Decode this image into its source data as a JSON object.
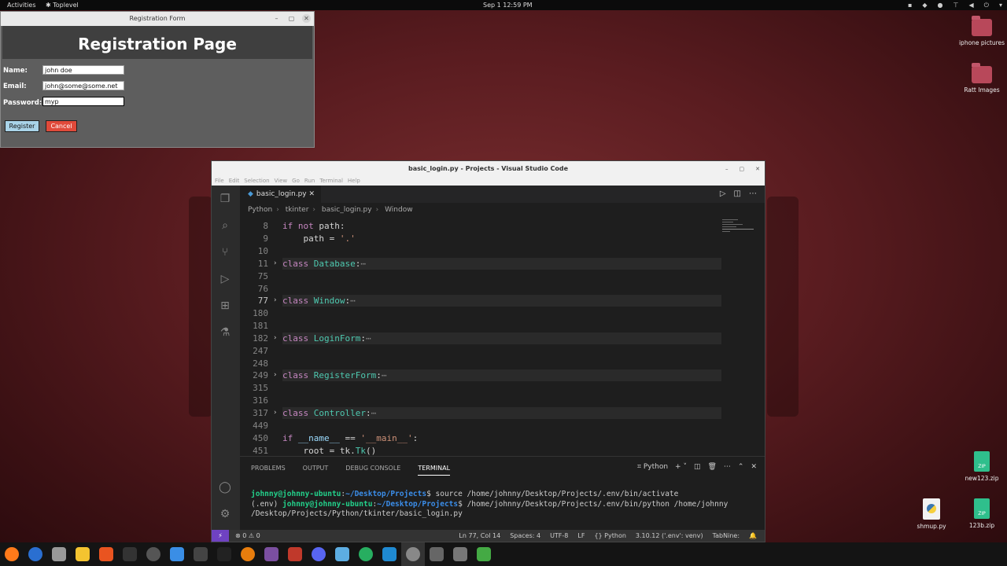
{
  "topbar": {
    "activities": "Activities",
    "app": "Toplevel",
    "clock": "Sep 1  12:59 PM"
  },
  "desktop": {
    "icons": [
      {
        "label": "iphone pictures",
        "type": "folder"
      },
      {
        "label": "Ratt Images",
        "type": "folder"
      },
      {
        "label": "new123.zip",
        "type": "zip"
      },
      {
        "label": "shmup.py",
        "type": "python"
      },
      {
        "label": "123b.zip",
        "type": "zip"
      }
    ]
  },
  "reg": {
    "window_title": "Registration Form",
    "heading": "Registration Page",
    "name_label": "Name:",
    "name_value": "john doe",
    "email_label": "Email:",
    "email_value": "john@some@some.net",
    "password_label": "Password:",
    "password_value": "myp",
    "register": "Register",
    "cancel": "Cancel"
  },
  "vscode": {
    "window_title": "basic_login.py - Projects - Visual Studio Code",
    "menu": [
      "File",
      "Edit",
      "Selection",
      "View",
      "Go",
      "Run",
      "Terminal",
      "Help"
    ],
    "tab": "basic_login.py",
    "breadcrumb": [
      "Python",
      "tkinter",
      "basic_login.py",
      "Window"
    ],
    "panel_tabs": [
      "PROBLEMS",
      "OUTPUT",
      "DEBUG CONSOLE",
      "TERMINAL"
    ],
    "terminal_profile": "Python",
    "terminal": {
      "line1_user": "johnny@johnny-ubuntu",
      "line1_path": "~/Desktop/Projects",
      "line1_cmd": "$ source /home/johnny/Desktop/Projects/.env/bin/activate",
      "line2_env": "(.env) ",
      "line2_user": "johnny@johnny-ubuntu",
      "line2_path": "~/Desktop/Projects",
      "line2_cmd": "$ /home/johnny/Desktop/Projects/.env/bin/python /home/johnny",
      "line3": "/Desktop/Projects/Python/tkinter/basic_login.py"
    },
    "status": {
      "errors": "⊗ 0 ⚠ 0",
      "position": "Ln 77, Col 14",
      "spaces": "Spaces: 4",
      "encoding": "UTF-8",
      "eol": "LF",
      "lang": "{} Python",
      "interp": "3.10.12 ('.env': venv)",
      "tabnine": "TabNine:"
    }
  },
  "colors": {
    "register_bg": "#a9d3e8",
    "cancel_bg": "#e04a3a",
    "accent": "#6f42c1"
  }
}
